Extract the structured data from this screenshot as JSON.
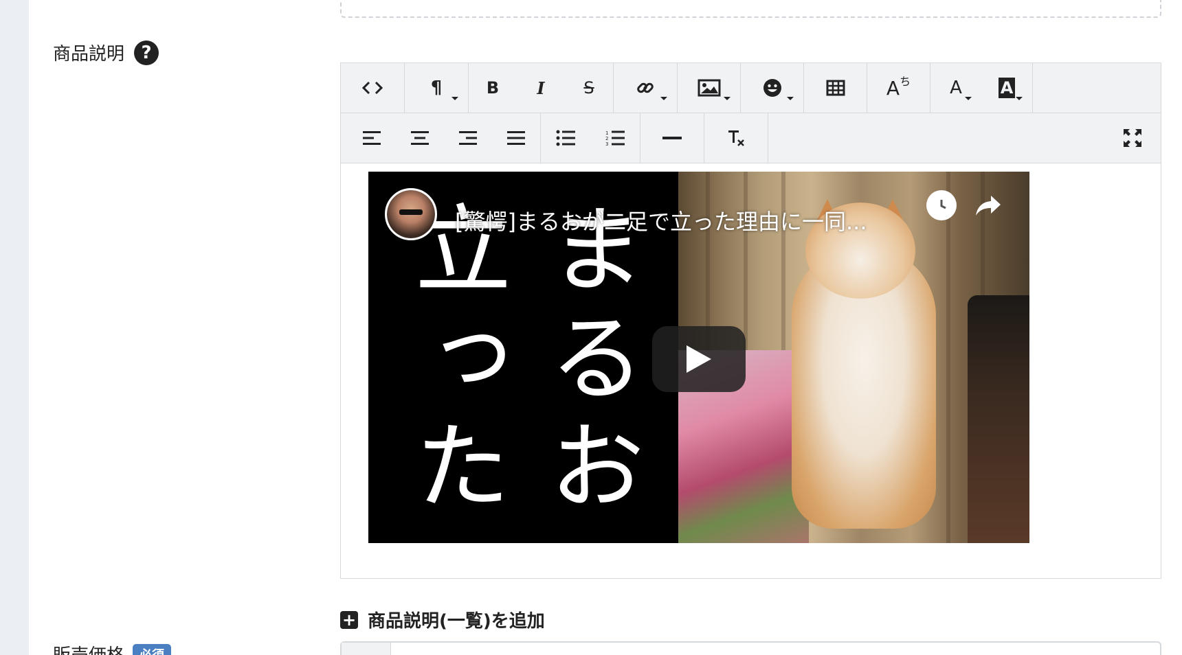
{
  "description_field": {
    "label": "商品説明",
    "help_icon": "question-circle-icon"
  },
  "editor": {
    "toolbar_row1": [
      {
        "name": "code-view-button",
        "icon": "code-icon"
      },
      {
        "name": "paragraph-style-button",
        "icon": "pilcrow-icon",
        "glyph": "¶",
        "dropdown": true
      },
      {
        "name": "bold-button",
        "icon": "bold-icon",
        "glyph": "B"
      },
      {
        "name": "italic-button",
        "icon": "italic-icon",
        "glyph": "I"
      },
      {
        "name": "strikethrough-button",
        "icon": "strikethrough-icon",
        "glyph": "S"
      },
      {
        "name": "link-button",
        "icon": "link-icon",
        "dropdown": true
      },
      {
        "name": "image-button",
        "icon": "image-icon",
        "dropdown": true
      },
      {
        "name": "emoji-button",
        "icon": "emoji-icon",
        "dropdown": true
      },
      {
        "name": "table-button",
        "icon": "table-icon"
      },
      {
        "name": "ruby-button",
        "icon": "ruby-icon",
        "glyph": "A",
        "sup": "ち"
      },
      {
        "name": "font-color-button",
        "icon": "font-color-icon",
        "glyph": "A",
        "dropdown": true
      },
      {
        "name": "background-color-button",
        "icon": "background-color-icon",
        "glyph": "A",
        "dropdown": true
      }
    ],
    "toolbar_row2": [
      {
        "name": "align-left-button",
        "icon": "align-left-icon"
      },
      {
        "name": "align-center-button",
        "icon": "align-center-icon"
      },
      {
        "name": "align-right-button",
        "icon": "align-right-icon"
      },
      {
        "name": "align-justify-button",
        "icon": "align-justify-icon"
      },
      {
        "name": "bullet-list-button",
        "icon": "bullet-list-icon"
      },
      {
        "name": "numbered-list-button",
        "icon": "numbered-list-icon"
      },
      {
        "name": "horizontal-rule-button",
        "icon": "horizontal-rule-icon"
      },
      {
        "name": "clear-format-button",
        "icon": "clear-format-icon"
      },
      {
        "name": "fullscreen-button",
        "icon": "fullscreen-icon"
      }
    ],
    "video": {
      "title": "[驚愕]まるおが二足で立った理由に一同...",
      "thumbnail_text_col1": "まるお",
      "thumbnail_text_col2": "立った",
      "watch_later_icon": "clock-icon",
      "share_icon": "share-arrow-icon",
      "play_icon": "play-icon"
    }
  },
  "add_description": {
    "label": "商品説明(一覧)を追加",
    "icon": "plus-square-icon"
  },
  "price_field": {
    "label": "販売価格",
    "badge": "必須"
  }
}
